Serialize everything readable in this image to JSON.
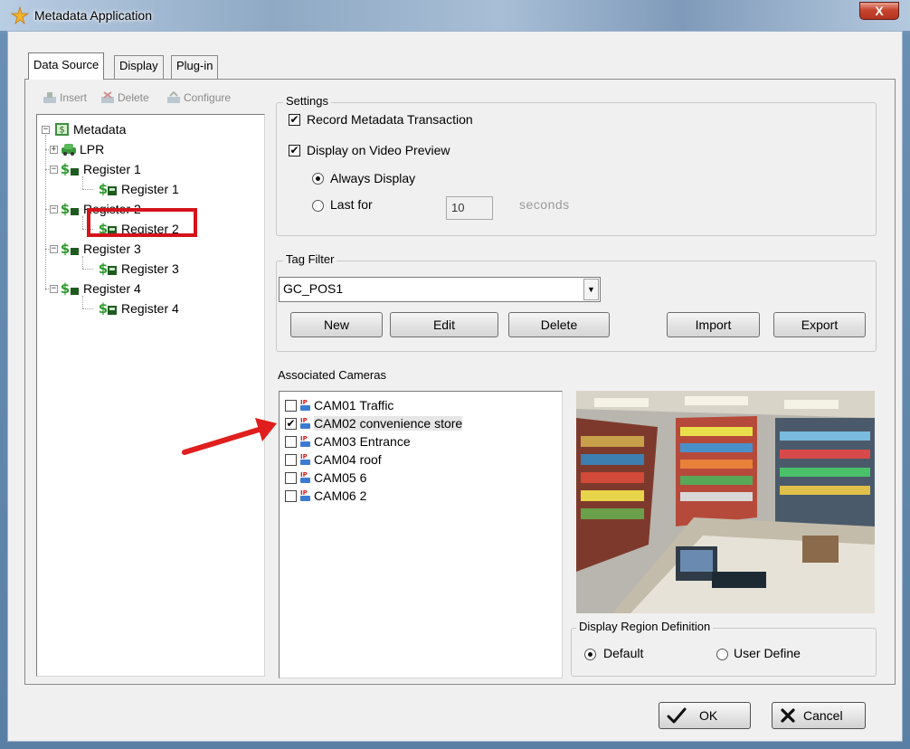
{
  "window": {
    "title": "Metadata Application",
    "close_label": "X"
  },
  "tabs": [
    {
      "label": "Data Source",
      "active": true
    },
    {
      "label": "Display",
      "active": false
    },
    {
      "label": "Plug-in",
      "active": false
    }
  ],
  "toolbar": {
    "insert": "Insert",
    "delete": "Delete",
    "configure": "Configure"
  },
  "tree": {
    "root": "Metadata",
    "lpr": "LPR",
    "registers": [
      {
        "label": "Register 1",
        "child": "Register 1"
      },
      {
        "label": "Register 2",
        "child": "Register 2"
      },
      {
        "label": "Register 3",
        "child": "Register 3"
      },
      {
        "label": "Register 4",
        "child": "Register 4"
      }
    ]
  },
  "settings": {
    "title": "Settings",
    "record_metadata": {
      "label": "Record Metadata Transaction",
      "checked": true
    },
    "display_preview": {
      "label": "Display on Video Preview",
      "checked": true
    },
    "always_display": {
      "label": "Always Display",
      "selected": true
    },
    "last_for": {
      "label": "Last for",
      "selected": false
    },
    "seconds_value": "10",
    "seconds_label": "seconds"
  },
  "tag_filter": {
    "title": "Tag Filter",
    "selected": "GC_POS1",
    "buttons": {
      "new": "New",
      "edit": "Edit",
      "delete": "Delete",
      "import": "Import",
      "export": "Export"
    }
  },
  "associated_cameras": {
    "title": "Associated Cameras",
    "cameras": [
      {
        "label": "CAM01 Traffic",
        "checked": false
      },
      {
        "label": "CAM02 convenience store",
        "checked": true
      },
      {
        "label": "CAM03 Entrance",
        "checked": false
      },
      {
        "label": "CAM04 roof",
        "checked": false
      },
      {
        "label": "CAM05 6",
        "checked": false
      },
      {
        "label": "CAM06 2",
        "checked": false
      }
    ]
  },
  "display_region": {
    "title": "Display Region Definition",
    "default": {
      "label": "Default",
      "selected": true
    },
    "user_define": {
      "label": "User Define",
      "selected": false
    }
  },
  "footer": {
    "ok": "OK",
    "cancel": "Cancel"
  },
  "colors": {
    "highlight_box": "#d4131b",
    "arrow": "#e01e1e",
    "tree_icon_green": "#2e9a2e"
  }
}
